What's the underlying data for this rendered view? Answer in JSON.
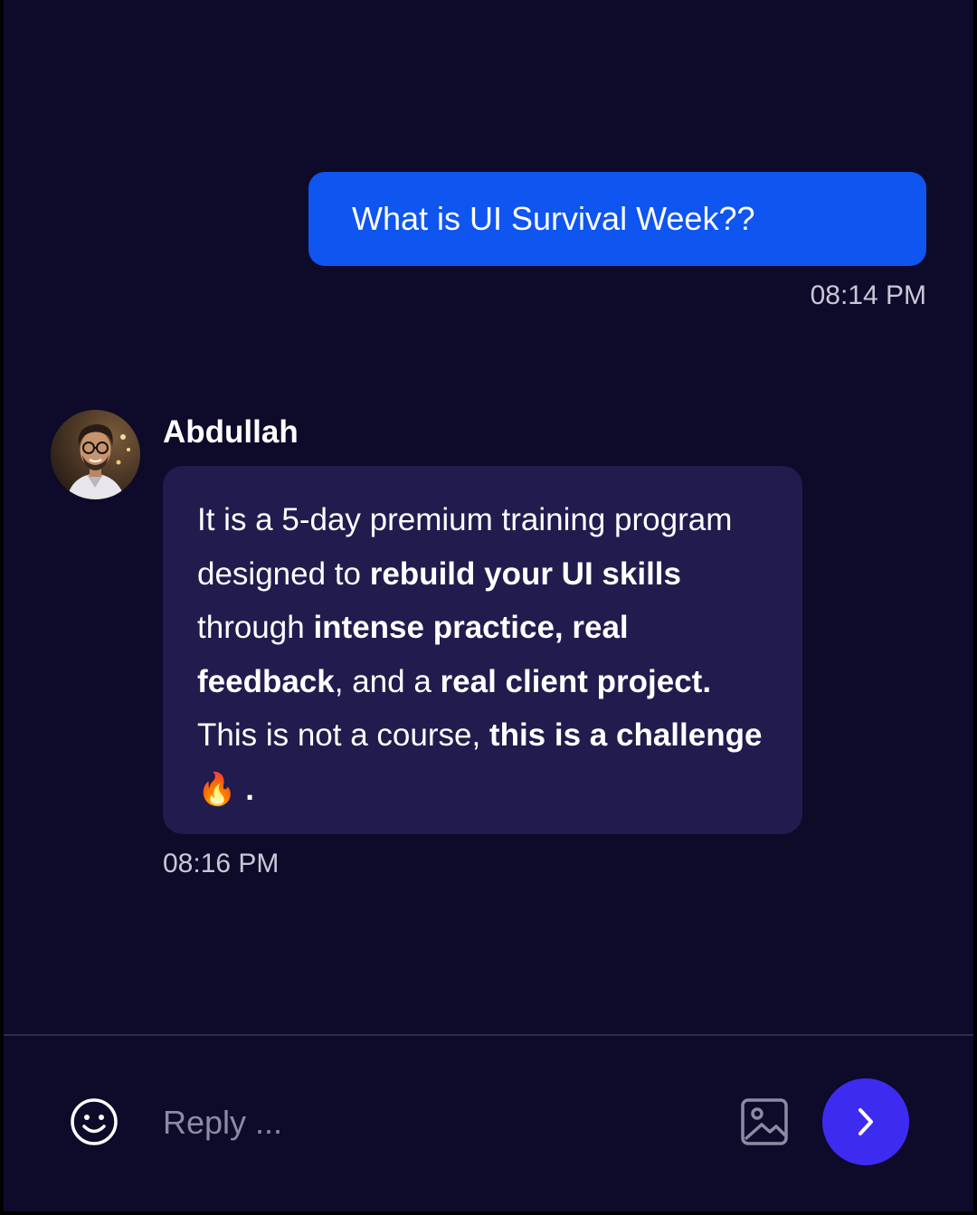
{
  "messages": {
    "sent": {
      "text": "What is UI Survival Week??",
      "time": "08:14 PM"
    },
    "received": {
      "sender": "Abdullah",
      "segments": [
        {
          "text": "It is a 5-day premium training program designed to ",
          "bold": false
        },
        {
          "text": "rebuild your UI skills",
          "bold": true
        },
        {
          "text": " through ",
          "bold": false
        },
        {
          "text": "intense practice, real feedback",
          "bold": true
        },
        {
          "text": ", and a ",
          "bold": false
        },
        {
          "text": "real client project.",
          "bold": true
        },
        {
          "text": " This is not a course, ",
          "bold": false
        },
        {
          "text": "this is a challenge",
          "bold": true
        },
        {
          "text": " 🔥 .",
          "bold": false
        }
      ],
      "time": "08:16 PM"
    }
  },
  "composer": {
    "placeholder": "Reply ...",
    "emoji_icon": "smiley-icon",
    "image_icon": "image-icon",
    "send_icon": "chevron-right-icon"
  },
  "colors": {
    "background": "#0e0a2a",
    "sent_bubble": "#0f55f0",
    "received_bubble": "#211b4e",
    "send_button": "#3d2cf0"
  }
}
